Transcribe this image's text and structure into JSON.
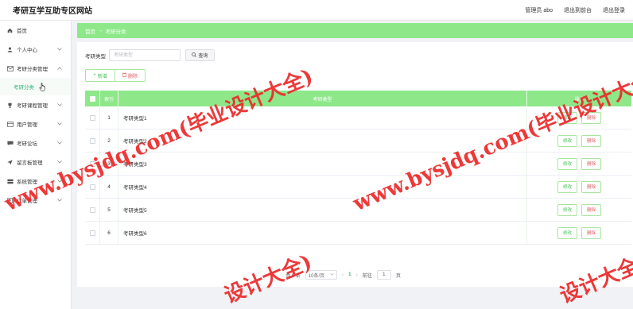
{
  "header": {
    "title": "考研互学互助专区网站",
    "admin_label": "管理员 abo",
    "to_frontend": "退出到前台",
    "logout": "退出登录"
  },
  "sidebar": {
    "items": [
      {
        "label": "首页"
      },
      {
        "label": "个人中心"
      },
      {
        "label": "考研分类管理",
        "sub": "考研分类"
      },
      {
        "label": "考研课程管理"
      },
      {
        "label": "用户管理"
      },
      {
        "label": "考研论坛"
      },
      {
        "label": "留言板管理"
      },
      {
        "label": "系统管理"
      },
      {
        "label": "订单管理"
      }
    ]
  },
  "breadcrumb": {
    "home": "首页",
    "sep": "→",
    "current": "考研分类"
  },
  "search": {
    "label": "考研类型",
    "placeholder": "考研类型",
    "button": "查询"
  },
  "actions": {
    "add": "新增",
    "delete": "删除"
  },
  "table": {
    "headers": {
      "index": "索引",
      "type": "考研类型",
      "action": "操作"
    },
    "rows": [
      {
        "index": "1",
        "type": "考研类型1"
      },
      {
        "index": "2",
        "type": "考研类型2"
      },
      {
        "index": "3",
        "type": "考研类型3"
      },
      {
        "index": "4",
        "type": "考研类型4"
      },
      {
        "index": "5",
        "type": "考研类型5"
      },
      {
        "index": "6",
        "type": "考研类型6"
      }
    ],
    "edit_label": "修改",
    "remove_label": "删除"
  },
  "pagination": {
    "total": "共 6 条",
    "page_size": "10条/页",
    "current_page": "1",
    "goto_label": "前往",
    "goto_value": "1",
    "page_unit": "页"
  },
  "watermark": {
    "text": "www.bysjdq.com(毕业设计大全)",
    "partial": "设计大全)"
  },
  "colors": {
    "accent": "#8ee88a",
    "primary_text": "#2bb673",
    "danger": "#e05b5b",
    "watermark": "#eb2828"
  }
}
